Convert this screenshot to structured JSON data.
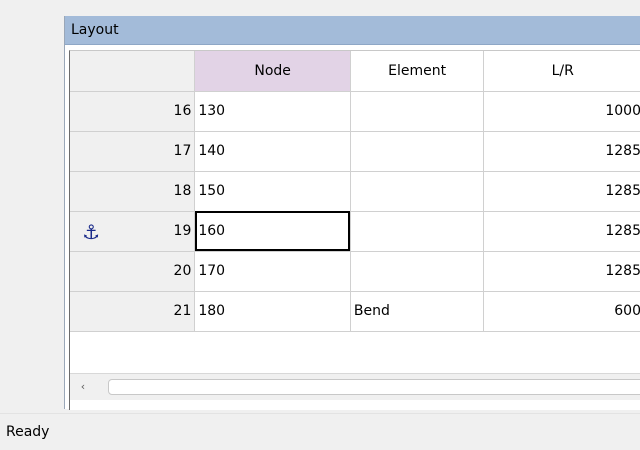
{
  "panel": {
    "title": "Layout"
  },
  "grid": {
    "columns": [
      "Node",
      "Element",
      "L/R"
    ],
    "rows": [
      {
        "num": "16",
        "node": "130",
        "element": "",
        "lr": "1000"
      },
      {
        "num": "17",
        "node": "140",
        "element": "",
        "lr": "1285"
      },
      {
        "num": "18",
        "node": "150",
        "element": "",
        "lr": "1285"
      },
      {
        "num": "19",
        "node": "160",
        "element": "",
        "lr": "1285",
        "anchor_icon": "anchor-icon"
      },
      {
        "num": "20",
        "node": "170",
        "element": "",
        "lr": "1285"
      },
      {
        "num": "21",
        "node": "180",
        "element": "Bend",
        "lr": "600"
      }
    ]
  },
  "scrollbar": {
    "left_arrow": "‹"
  },
  "status": {
    "text": "Ready"
  },
  "colors": {
    "header_bg": "#a3bbd9",
    "node_column_bg": "#e2d3e6",
    "anchor": "#1a2a8a"
  }
}
